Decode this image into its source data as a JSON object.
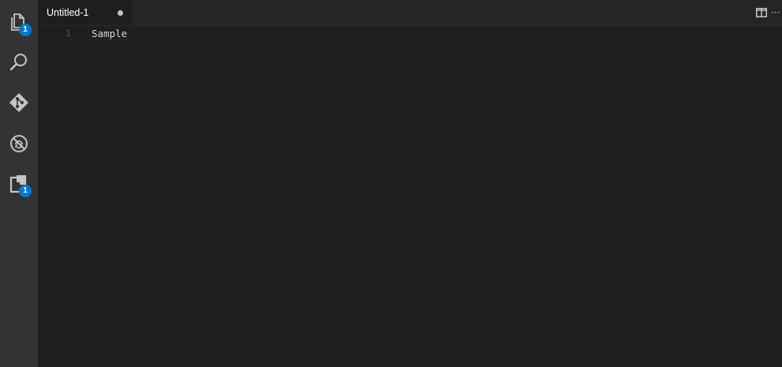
{
  "activity_bar": {
    "items": [
      {
        "name": "explorer",
        "icon": "files-icon",
        "badge": "1"
      },
      {
        "name": "search",
        "icon": "search-icon",
        "badge": ""
      },
      {
        "name": "source-control",
        "icon": "git-icon",
        "badge": ""
      },
      {
        "name": "debug",
        "icon": "debug-icon",
        "badge": ""
      },
      {
        "name": "extensions",
        "icon": "extensions-icon",
        "badge": "1"
      }
    ]
  },
  "editor": {
    "tabs": [
      {
        "label": "Untitled-1",
        "dirty": true
      }
    ],
    "lines": [
      {
        "number": "1",
        "text": "Sample"
      }
    ]
  },
  "colors": {
    "activity_bar_bg": "#333333",
    "editor_bg": "#1e1e1e",
    "tab_strip_bg": "#252526",
    "badge_bg": "#007acc",
    "icon_color": "#c5c5c5"
  }
}
